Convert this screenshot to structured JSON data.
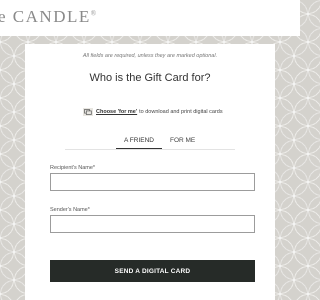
{
  "header": {
    "logo_text": "e CANDLE",
    "logo_mark": "®"
  },
  "form": {
    "required_note": "All fields are required, unless they are marked optional.",
    "heading": "Who is the Gift Card for?",
    "tip": {
      "icon": "cards-icon",
      "link_text": "Choose 'for me'",
      "text": "to download and print digital cards"
    },
    "tabs": [
      {
        "label": "A FRIEND",
        "active": true
      },
      {
        "label": "FOR ME",
        "active": false
      }
    ],
    "recipient_name": {
      "label": "Recipient's Name*",
      "value": "",
      "placeholder": ""
    },
    "sender_name": {
      "label": "Sender's Name*",
      "value": "",
      "placeholder": ""
    },
    "submit_label": "SEND A DIGITAL CARD"
  },
  "colors": {
    "button_bg": "#262b28",
    "pattern_bg": "#d4d2cd",
    "logo_text": "#8a8a8a"
  }
}
